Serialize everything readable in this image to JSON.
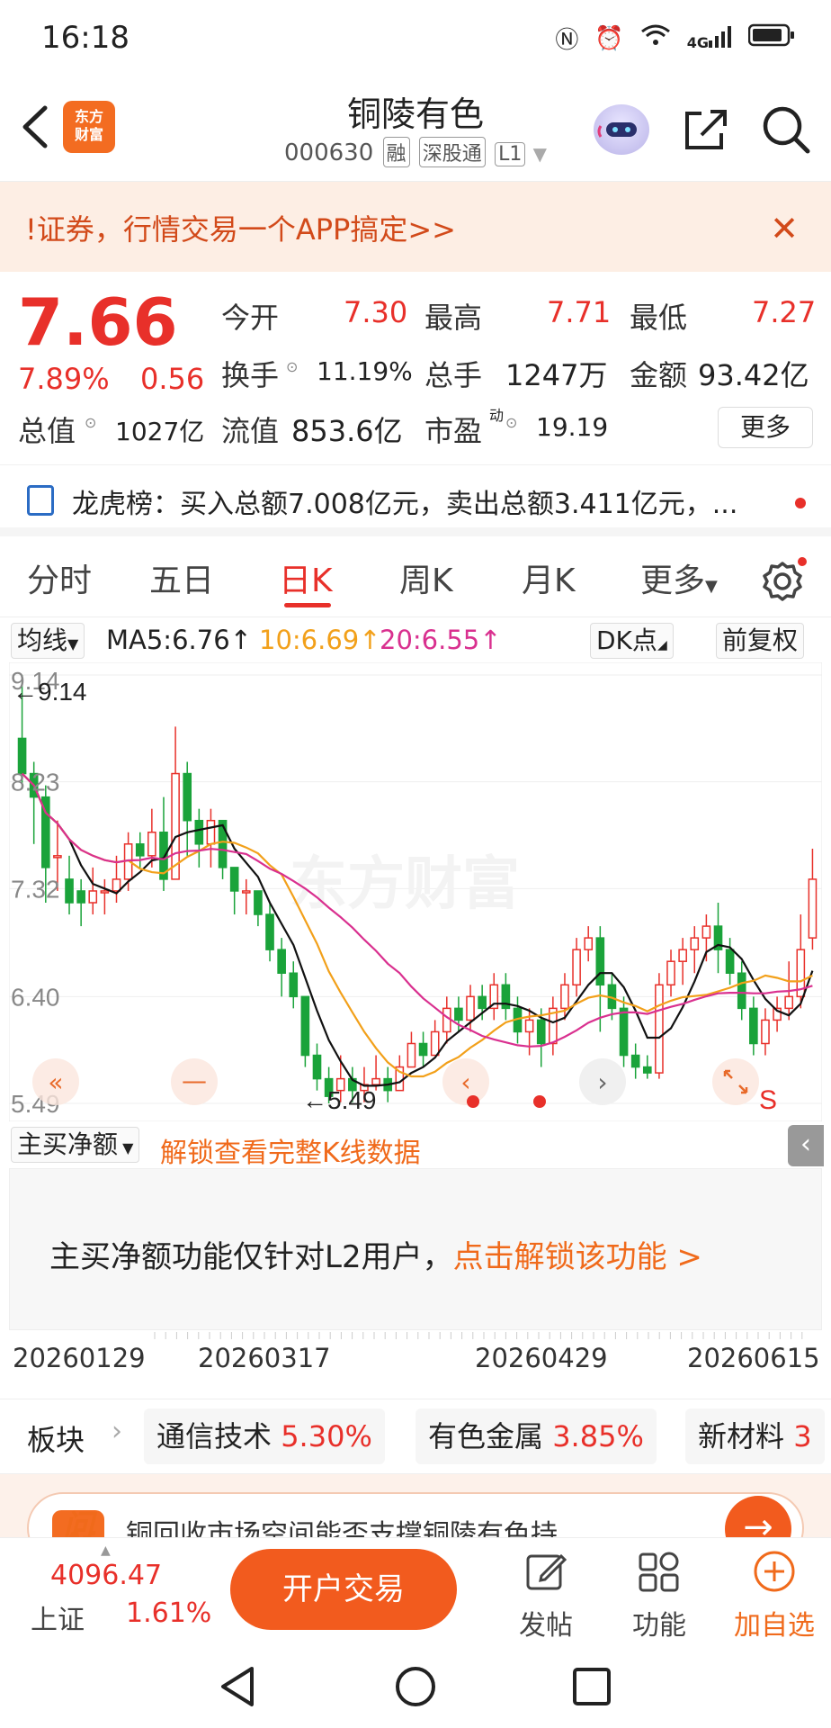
{
  "status": {
    "time": "16:18",
    "network": "4G"
  },
  "header": {
    "logo_line1": "东方",
    "logo_line2": "财富",
    "stock_name": "铜陵有色",
    "stock_code": "000630",
    "tags": [
      "融",
      "深股通",
      "L1"
    ]
  },
  "banner": {
    "text": "!证券，行情交易一个APP搞定>>"
  },
  "quote": {
    "price": "7.66",
    "change_pct": "7.89%",
    "change_amt": "0.56",
    "open_label": "今开",
    "open": "7.30",
    "high_label": "最高",
    "high": "7.71",
    "low_label": "最低",
    "low": "7.27",
    "turnover_label": "换手",
    "turnover": "11.19%",
    "volume_label": "总手",
    "volume": "1247万",
    "amount_label": "金额",
    "amount": "93.42亿",
    "mktcap_label": "总值",
    "mktcap": "1027亿",
    "float_label": "流值",
    "float": "853.6亿",
    "pe_label": "市盈",
    "pe_sup": "动",
    "pe": "19.19",
    "more": "更多"
  },
  "news": {
    "text": "龙虎榜：买入总额7.008亿元，卖出总额3.411亿元，..."
  },
  "tabs": [
    "分时",
    "五日",
    "日K",
    "周K",
    "月K",
    "更多"
  ],
  "active_tab": "日K",
  "ma": {
    "selector": "均线",
    "ma5": "MA5:6.76↑",
    "ma10": "10:6.69↑",
    "ma20": "20:6.55↑",
    "dk": "DK点",
    "adjust": "前复权",
    "colors": {
      "ma5": "#111111",
      "ma10": "#f2a01a",
      "ma20": "#d9308f",
      "up": "#e8302a",
      "down": "#1aa33a"
    }
  },
  "chart_labels": {
    "y_ticks": [
      "9.14",
      "8.23",
      "7.32",
      "6.40",
      "5.49"
    ],
    "max_marker": "←9.14",
    "min_marker": "←5.49",
    "watermark": "东方财富",
    "signal": "S"
  },
  "chart_data": {
    "type": "candlestick",
    "ylim": [
      5.49,
      9.14
    ],
    "y_ticks": [
      9.14,
      8.23,
      7.32,
      6.4,
      5.49
    ],
    "x_ticks": [
      "20260129",
      "20260317",
      "20260429",
      "20260615"
    ],
    "ma_series": [
      {
        "name": "MA5",
        "last": 6.76
      },
      {
        "name": "10",
        "last": 6.69
      },
      {
        "name": "20",
        "last": 6.55
      }
    ],
    "candles": [
      [
        8.6,
        8.3,
        9.14,
        8.2
      ],
      [
        8.3,
        8.1,
        8.4,
        7.7
      ],
      [
        8.1,
        7.5,
        8.2,
        7.2
      ],
      [
        7.6,
        7.6,
        7.9,
        7.3
      ],
      [
        7.4,
        7.2,
        7.6,
        7.1
      ],
      [
        7.3,
        7.2,
        7.4,
        7.0
      ],
      [
        7.2,
        7.3,
        7.5,
        7.1
      ],
      [
        7.3,
        7.3,
        7.4,
        7.1
      ],
      [
        7.3,
        7.4,
        7.6,
        7.2
      ],
      [
        7.4,
        7.7,
        7.8,
        7.3
      ],
      [
        7.7,
        7.6,
        7.8,
        7.5
      ],
      [
        7.6,
        7.8,
        8.0,
        7.5
      ],
      [
        7.8,
        7.4,
        8.1,
        7.3
      ],
      [
        7.4,
        8.3,
        8.7,
        7.4
      ],
      [
        8.3,
        7.9,
        8.4,
        7.6
      ],
      [
        7.9,
        7.7,
        8.0,
        7.5
      ],
      [
        7.7,
        7.9,
        8.0,
        7.5
      ],
      [
        7.9,
        7.5,
        7.9,
        7.4
      ],
      [
        7.5,
        7.3,
        7.5,
        7.1
      ],
      [
        7.3,
        7.3,
        7.4,
        7.1
      ],
      [
        7.3,
        7.1,
        7.3,
        7.0
      ],
      [
        7.1,
        6.8,
        7.2,
        6.7
      ],
      [
        6.8,
        6.6,
        6.9,
        6.4
      ],
      [
        6.6,
        6.4,
        6.7,
        6.3
      ],
      [
        6.4,
        5.9,
        6.4,
        5.8
      ],
      [
        5.9,
        5.7,
        6.0,
        5.6
      ],
      [
        5.7,
        5.55,
        5.8,
        5.49
      ],
      [
        5.6,
        5.7,
        5.9,
        5.5
      ],
      [
        5.7,
        5.6,
        5.8,
        5.5
      ],
      [
        5.6,
        5.65,
        5.8,
        5.5
      ],
      [
        5.65,
        5.7,
        5.9,
        5.6
      ],
      [
        5.7,
        5.6,
        5.8,
        5.5
      ],
      [
        5.6,
        5.8,
        5.9,
        5.6
      ],
      [
        5.8,
        6.0,
        6.1,
        5.8
      ],
      [
        6.0,
        5.9,
        6.1,
        5.8
      ],
      [
        5.9,
        6.1,
        6.2,
        5.9
      ],
      [
        6.1,
        6.3,
        6.4,
        6.0
      ],
      [
        6.3,
        6.2,
        6.4,
        6.1
      ],
      [
        6.2,
        6.4,
        6.5,
        6.1
      ],
      [
        6.4,
        6.3,
        6.5,
        6.2
      ],
      [
        6.3,
        6.5,
        6.6,
        6.2
      ],
      [
        6.5,
        6.3,
        6.6,
        6.2
      ],
      [
        6.3,
        6.1,
        6.4,
        6.0
      ],
      [
        6.1,
        6.2,
        6.3,
        5.9
      ],
      [
        6.2,
        6.0,
        6.3,
        5.8
      ],
      [
        6.0,
        6.3,
        6.4,
        5.9
      ],
      [
        6.3,
        6.5,
        6.6,
        6.2
      ],
      [
        6.5,
        6.8,
        6.9,
        6.4
      ],
      [
        6.8,
        6.9,
        7.0,
        6.7
      ],
      [
        6.9,
        6.5,
        7.0,
        6.1
      ],
      [
        6.5,
        6.3,
        6.6,
        6.2
      ],
      [
        6.3,
        5.9,
        6.4,
        5.8
      ],
      [
        5.9,
        5.8,
        6.0,
        5.7
      ],
      [
        5.8,
        5.75,
        5.9,
        5.7
      ],
      [
        5.75,
        6.5,
        6.6,
        5.7
      ],
      [
        6.5,
        6.7,
        6.8,
        6.4
      ],
      [
        6.7,
        6.8,
        6.9,
        6.5
      ],
      [
        6.8,
        6.9,
        7.0,
        6.6
      ],
      [
        6.9,
        7.0,
        7.1,
        6.7
      ],
      [
        7.0,
        6.8,
        7.2,
        6.6
      ],
      [
        6.8,
        6.6,
        6.9,
        6.5
      ],
      [
        6.6,
        6.3,
        6.7,
        6.2
      ],
      [
        6.3,
        6.0,
        6.4,
        5.9
      ],
      [
        6.0,
        6.2,
        6.3,
        5.9
      ],
      [
        6.2,
        6.3,
        6.4,
        6.1
      ],
      [
        6.3,
        6.4,
        6.7,
        6.2
      ],
      [
        6.4,
        6.8,
        7.1,
        6.3
      ],
      [
        6.9,
        7.4,
        7.66,
        6.8
      ]
    ]
  },
  "sub_indicator": {
    "selector": "主买净额",
    "unlock_tip": "解锁查看完整K线数据",
    "locked_text": "主买净额功能仅针对L2用户，",
    "unlock_link": "点击解锁该功能 >"
  },
  "dates": [
    "20260129",
    "20260317",
    "20260429",
    "20260615"
  ],
  "sectors": {
    "label": "板块",
    "items": [
      {
        "name": "通信技术",
        "pct": "5.30%"
      },
      {
        "name": "有色金属",
        "pct": "3.85%"
      },
      {
        "name": "新材料",
        "pct": "3"
      }
    ]
  },
  "ai": {
    "logo": "问Ai",
    "text": "铜回收市场空间能否支撑铜陵有色持"
  },
  "bottom": {
    "index_value": "4096.47",
    "index_name": "上证",
    "index_pct": "1.61%",
    "trade": "开户交易",
    "post": "发帖",
    "functions": "功能",
    "add": "加自选"
  }
}
